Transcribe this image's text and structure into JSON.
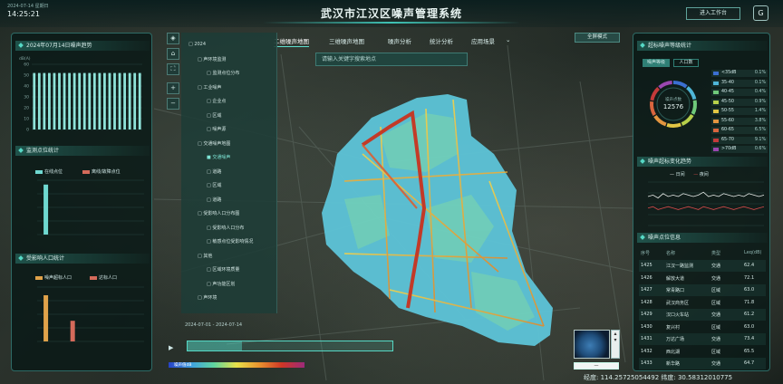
{
  "header": {
    "title": "武汉市江汉区噪声管理系统",
    "date_small": "2024-07-14  星期日",
    "time": "14:25:21",
    "login_button": "进入工作台",
    "g_button": "G"
  },
  "nav": {
    "tabs": [
      {
        "label": "二维噪声地图"
      },
      {
        "label": "三维噪声地图"
      },
      {
        "label": "噪声分析"
      },
      {
        "label": "统计分析"
      },
      {
        "label": "应用场景"
      }
    ],
    "search_placeholder": "请输入关键字搜索地点",
    "map_toggle": "全屏模式"
  },
  "left_panel": {
    "noise_title": "2024年07月14日噪声趋势",
    "noise_unit": "dB(A)",
    "noise_bars": [
      52,
      52,
      52,
      52,
      52,
      52,
      52,
      52,
      52,
      52,
      52,
      52,
      52,
      52,
      52,
      52,
      52,
      52,
      52,
      52,
      52,
      52
    ],
    "noise_y_ticks": [
      "60",
      "50",
      "40",
      "30",
      "20",
      "10",
      "0"
    ],
    "monitor_title": "监测点位统计",
    "monitor_legend": [
      {
        "label": "在线点位",
        "color": "#6fd8d0"
      },
      {
        "label": "离线/故障点位",
        "color": "#d46a5a"
      }
    ],
    "monitor_bars": [
      {
        "online": 92,
        "offline": 0
      },
      {
        "online": 0,
        "offline": 0
      },
      {
        "online": 0,
        "offline": 0
      },
      {
        "online": 0,
        "offline": 0
      },
      {
        "online": 0,
        "offline": 0
      }
    ],
    "population_title": "受影响人口统计",
    "population_legend": [
      {
        "label": "噪声超标人口",
        "color": "#e0a24a"
      },
      {
        "label": "达标人口",
        "color": "#d46a5a"
      }
    ],
    "population_bars": [
      {
        "a": 85,
        "b": 0
      },
      {
        "a": 0,
        "b": 38
      },
      {
        "a": 0,
        "b": 0
      },
      {
        "a": 0,
        "b": 0
      },
      {
        "a": 0,
        "b": 0
      }
    ]
  },
  "tree": {
    "items": [
      {
        "label": "2024",
        "indent": 0
      },
      {
        "label": "声环境监测",
        "indent": 1
      },
      {
        "label": "监测点位分布",
        "indent": 2
      },
      {
        "label": "工业噪声",
        "indent": 1
      },
      {
        "label": "企业点",
        "indent": 2
      },
      {
        "label": "区域",
        "indent": 2
      },
      {
        "label": "噪声源",
        "indent": 2
      },
      {
        "label": "交通噪声地图",
        "indent": 1
      },
      {
        "label": "交通噪声",
        "indent": 2,
        "selected": true
      },
      {
        "label": "道路",
        "indent": 2
      },
      {
        "label": "区域",
        "indent": 2
      },
      {
        "label": "道路",
        "indent": 2
      },
      {
        "label": "受影响人口分布图",
        "indent": 1
      },
      {
        "label": "受影响人口分布",
        "indent": 2
      },
      {
        "label": "敏感点位受影响情况",
        "indent": 2
      },
      {
        "label": "其他",
        "indent": 1
      },
      {
        "label": "区域环境质量",
        "indent": 2
      },
      {
        "label": "声功能区划",
        "indent": 2
      },
      {
        "label": "声环境",
        "indent": 1
      }
    ]
  },
  "timeline": {
    "range_label": "2024-07-01  -  2024-07-14",
    "legend_label": "噪声值dB"
  },
  "right_panel": {
    "level_title": "超标噪声等级统计",
    "level_tabs": [
      "噪声等级",
      "人口数"
    ],
    "donut_label": "噪声点数",
    "donut_value": "12576",
    "levels": [
      {
        "label": "<35dB",
        "value": "0.1%",
        "color": "#3b6fd1"
      },
      {
        "label": "35-40",
        "value": "0.1%",
        "color": "#4fb6d8"
      },
      {
        "label": "40-45",
        "value": "0.4%",
        "color": "#6fc97a"
      },
      {
        "label": "45-50",
        "value": "0.9%",
        "color": "#b7d04a"
      },
      {
        "label": "50-55",
        "value": "1.4%",
        "color": "#e2c544"
      },
      {
        "label": "55-60",
        "value": "3.8%",
        "color": "#e39540"
      },
      {
        "label": "60-65",
        "value": "6.5%",
        "color": "#d9653e"
      },
      {
        "label": "65-70",
        "value": "9.1%",
        "color": "#c43a3a"
      },
      {
        "label": ">70dB",
        "value": "0.6%",
        "color": "#9a47b0"
      }
    ],
    "trend_title": "噪声超标变化趋势",
    "trend_legend": [
      "日间",
      "夜间"
    ],
    "trend_day": [
      60,
      61,
      59,
      62,
      60,
      61,
      60,
      62,
      61,
      60,
      61,
      63,
      60,
      61,
      60,
      62,
      61,
      60,
      61,
      60,
      62,
      61,
      60,
      61
    ],
    "trend_night": [
      52,
      53,
      51,
      52,
      53,
      52,
      51,
      52,
      53,
      52,
      51,
      53,
      52,
      51,
      52,
      53,
      52,
      51,
      52,
      53,
      52,
      51,
      52,
      53
    ],
    "table_title": "噪声点位信息",
    "table_headers": [
      "序号",
      "名称",
      "类型",
      "Leq(dB)"
    ],
    "table_rows": [
      [
        "1425",
        "江汉一路监测",
        "交通",
        "62.4"
      ],
      [
        "1426",
        "解放大道",
        "交通",
        "72.1"
      ],
      [
        "1427",
        "常青路口",
        "区域",
        "63.0"
      ],
      [
        "1428",
        "武汉商务区",
        "区域",
        "71.8"
      ],
      [
        "1429",
        "汉口火车站",
        "交通",
        "61.2"
      ],
      [
        "1430",
        "复兴村",
        "区域",
        "63.0"
      ],
      [
        "1431",
        "万达广场",
        "交通",
        "73.4"
      ],
      [
        "1432",
        "西北湖",
        "区域",
        "65.5"
      ],
      [
        "1433",
        "新华路",
        "交通",
        "64.7"
      ]
    ]
  },
  "status": {
    "coords": "经度: 114.25725054492  纬度: 30.58312010775"
  },
  "colors": {
    "accent": "#56d8c5",
    "panel_border": "#2e6b66",
    "noise_red": "#c8331f",
    "noise_cyan": "#58c8e0"
  }
}
